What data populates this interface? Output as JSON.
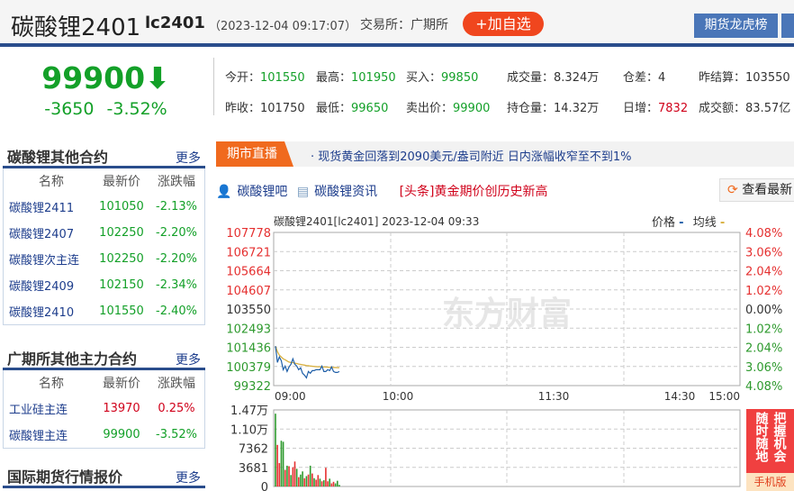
{
  "header": {
    "name": "碳酸锂2401",
    "code": "lc2401",
    "time": "（2023-12-04 09:17:07）",
    "exchange": "交易所：广期所",
    "add_button": "+加自选",
    "lhb_button": "期货龙虎榜"
  },
  "price": {
    "last": "99900",
    "arrow": "⬇",
    "change": "-3650",
    "change_pct": "-3.52%"
  },
  "quote": [
    {
      "label": "今开：",
      "value": "101550",
      "color": "g"
    },
    {
      "label": "最高：",
      "value": "101950",
      "color": "g"
    },
    {
      "label": "买入：",
      "value": "99850",
      "color": "g"
    },
    {
      "label": "成交量：",
      "value": "8.324万",
      "color": ""
    },
    {
      "label": "仓差：",
      "value": "4",
      "color": ""
    },
    {
      "label": "昨结算：",
      "value": "103550",
      "color": ""
    },
    {
      "label": "昨收：",
      "value": "101750",
      "color": ""
    },
    {
      "label": "最低：",
      "value": "99650",
      "color": "g"
    },
    {
      "label": "卖出价：",
      "value": "99900",
      "color": "g"
    },
    {
      "label": "持仓量：",
      "value": "14.32万",
      "color": ""
    },
    {
      "label": "日增：",
      "value": "7832",
      "color": "r"
    },
    {
      "label": "成交额：",
      "value": "83.57亿",
      "color": ""
    }
  ],
  "panels": [
    {
      "title": "碳酸锂其他合约",
      "more": "更多",
      "headers": [
        "名称",
        "最新价",
        "涨跌幅"
      ],
      "rows": [
        {
          "name": "碳酸锂2411",
          "price": "101050",
          "pct": "-2.13%",
          "color": "g"
        },
        {
          "name": "碳酸锂2407",
          "price": "102250",
          "pct": "-2.20%",
          "color": "g"
        },
        {
          "name": "碳酸锂次主连",
          "price": "102250",
          "pct": "-2.20%",
          "color": "g"
        },
        {
          "name": "碳酸锂2409",
          "price": "102150",
          "pct": "-2.34%",
          "color": "g"
        },
        {
          "name": "碳酸锂2410",
          "price": "101550",
          "pct": "-2.40%",
          "color": "g"
        }
      ]
    },
    {
      "title": "广期所其他主力合约",
      "more": "更多",
      "headers": [
        "名称",
        "最新价",
        "涨跌幅"
      ],
      "rows": [
        {
          "name": "工业硅主连",
          "price": "13970",
          "pct": "0.25%",
          "color": "r"
        },
        {
          "name": "碳酸锂主连",
          "price": "99900",
          "pct": "-3.52%",
          "color": "g"
        }
      ]
    },
    {
      "title": "国际期货行情报价",
      "more": "更多"
    }
  ],
  "news": {
    "tag": "期市直播",
    "text": "· 现货黄金回落到2090美元/盎司附近 日内涨幅收窄至不到1%"
  },
  "links": {
    "bar": "碳酸锂吧",
    "info": "碳酸锂资讯",
    "headline": "[头条]黄金期价创历史新高",
    "refresh": "查看最新"
  },
  "chart_title": "碳酸锂2401[lc2401] 2023-12-04 09:33",
  "legend": {
    "price": "价格",
    "avg": "均线",
    "price_color": "#1f5fa8",
    "avg_color": "#d8b040"
  },
  "watermark": "东方财富",
  "ad": {
    "col1": "把握机会",
    "col2": "随时随地",
    "bottom": "手机版"
  },
  "chart_data": {
    "type": "line",
    "title": "碳酸锂2401[lc2401] 2023-12-04 09:33",
    "x_ticks": [
      "09:00",
      "10:00",
      "11:30",
      "14:30",
      "15:00"
    ],
    "y_ticks": [
      "107778",
      "106721",
      "105664",
      "104607",
      "103550",
      "102493",
      "101436",
      "100379",
      "99322"
    ],
    "y_pct_ticks": [
      "4.08%",
      "3.06%",
      "2.04%",
      "1.02%",
      "0.00%",
      "1.02%",
      "2.04%",
      "3.06%",
      "4.08%"
    ],
    "ylim": [
      99322,
      107778
    ],
    "prev_settle": 103550,
    "minutes": [
      0,
      1,
      2,
      3,
      4,
      5,
      6,
      7,
      8,
      9,
      10,
      11,
      12,
      13,
      14,
      15,
      16,
      17,
      18,
      19,
      20,
      21,
      22,
      23,
      24,
      25,
      26,
      27,
      28,
      29,
      30,
      31,
      32,
      33
    ],
    "price": [
      101500,
      100600,
      100900,
      100700,
      100200,
      100400,
      100100,
      100350,
      100500,
      100800,
      100500,
      100400,
      100200,
      100300,
      100000,
      99900,
      99750,
      100100,
      100000,
      100150,
      100150,
      100200,
      100200,
      100200,
      100400,
      100100,
      100100,
      100200,
      100150,
      100350,
      100100,
      100050,
      100050,
      100100
    ],
    "avg": [
      101500,
      101200,
      101000,
      100900,
      100800,
      100750,
      100680,
      100620,
      100600,
      100590,
      100560,
      100540,
      100510,
      100490,
      100470,
      100450,
      100430,
      100420,
      100400,
      100390,
      100380,
      100370,
      100360,
      100360,
      100350,
      100350,
      100340,
      100340,
      100330,
      100330,
      100320,
      100320,
      100310,
      100310
    ],
    "vol_ticks": [
      "1.47万",
      "1.10万",
      "7362",
      "3681",
      "0"
    ],
    "vol_max": 14724,
    "volume": [
      14000,
      8000,
      4500,
      8800,
      8600,
      3200,
      4000,
      3900,
      2200,
      3700,
      4800,
      3400,
      1800,
      2300,
      2900,
      1600,
      2000,
      2300,
      4000,
      2500,
      1600,
      1300,
      2200,
      1500,
      1000,
      1200,
      3600,
      1000,
      1500,
      600,
      900,
      600,
      1100,
      300
    ],
    "vol_dir": [
      "g",
      "r",
      "r",
      "g",
      "g",
      "r",
      "g",
      "r",
      "g",
      "r",
      "r",
      "g",
      "r",
      "g",
      "g",
      "r",
      "g",
      "r",
      "g",
      "r",
      "g",
      "r",
      "r",
      "g",
      "r",
      "g",
      "r",
      "r",
      "g",
      "r",
      "r",
      "g",
      "g",
      "g"
    ]
  }
}
